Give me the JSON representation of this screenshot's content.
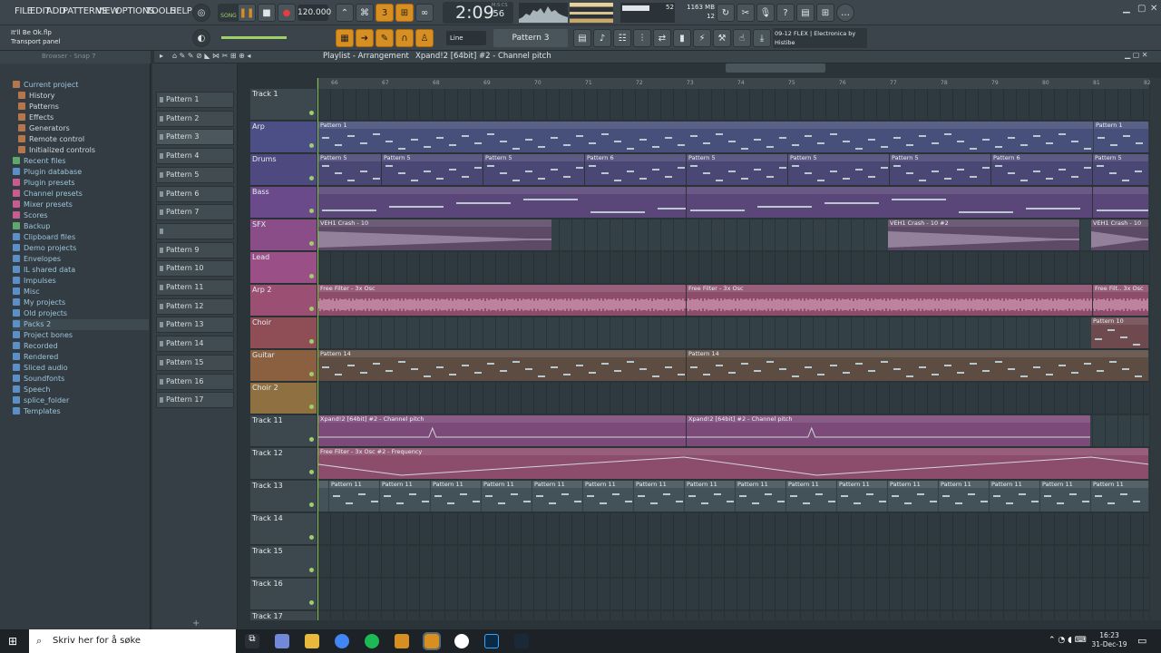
{
  "menu": [
    "FILE",
    "EDIT",
    "ADD",
    "PATTERNS",
    "VIEW",
    "OPTIONS",
    "TOOLS",
    "HELP"
  ],
  "transport": {
    "tempo": "120.000",
    "song_label": "SONG",
    "time": "2:09",
    "time_small": ":56",
    "time_unit": "M:S:CS",
    "cpu": "52",
    "mem": "1163 MB",
    "mem_sub": "12"
  },
  "project": {
    "file": "It'll Be Ok.flp",
    "hint": "Transport panel"
  },
  "toolbar2": {
    "snap_mode": "Line",
    "pattern": "Pattern 3",
    "news": "09-12 FLEX | Electronica by Histibe"
  },
  "browser": {
    "title": "Browser - Snap 7",
    "items": [
      {
        "label": "Current project",
        "type": "top",
        "color": "#b5764b"
      },
      {
        "label": "History",
        "type": "sub",
        "color": "#b5764b"
      },
      {
        "label": "Patterns",
        "type": "sub",
        "color": "#b5764b"
      },
      {
        "label": "Effects",
        "type": "sub",
        "color": "#b5764b"
      },
      {
        "label": "Generators",
        "type": "sub",
        "color": "#b5764b"
      },
      {
        "label": "Remote control",
        "type": "sub",
        "color": "#b5764b"
      },
      {
        "label": "Initialized controls",
        "type": "sub",
        "color": "#b5764b"
      },
      {
        "label": "Recent files",
        "type": "top",
        "color": "#5fa86b"
      },
      {
        "label": "Plugin database",
        "type": "top",
        "color": "#5b8fc8"
      },
      {
        "label": "Plugin presets",
        "type": "top",
        "color": "#c85b8f"
      },
      {
        "label": "Channel presets",
        "type": "top",
        "color": "#c85b8f"
      },
      {
        "label": "Mixer presets",
        "type": "top",
        "color": "#c85b8f"
      },
      {
        "label": "Scores",
        "type": "top",
        "color": "#c85b8f"
      },
      {
        "label": "Backup",
        "type": "top",
        "color": "#5fa86b"
      },
      {
        "label": "Clipboard files",
        "type": "top",
        "color": "#5b8fc8"
      },
      {
        "label": "Demo projects",
        "type": "top",
        "color": "#5b8fc8"
      },
      {
        "label": "Envelopes",
        "type": "top",
        "color": "#5b8fc8"
      },
      {
        "label": "IL shared data",
        "type": "top",
        "color": "#5b8fc8"
      },
      {
        "label": "Impulses",
        "type": "top",
        "color": "#5b8fc8"
      },
      {
        "label": "Misc",
        "type": "top",
        "color": "#5b8fc8"
      },
      {
        "label": "My projects",
        "type": "top",
        "color": "#5b8fc8"
      },
      {
        "label": "Old projects",
        "type": "top",
        "color": "#5b8fc8"
      },
      {
        "label": "Packs 2",
        "type": "top",
        "color": "#5b8fc8"
      },
      {
        "label": "Project bones",
        "type": "top",
        "color": "#5b8fc8"
      },
      {
        "label": "Recorded",
        "type": "top",
        "color": "#5b8fc8"
      },
      {
        "label": "Rendered",
        "type": "top",
        "color": "#5b8fc8"
      },
      {
        "label": "Sliced audio",
        "type": "top",
        "color": "#5b8fc8"
      },
      {
        "label": "Soundfonts",
        "type": "top",
        "color": "#5b8fc8"
      },
      {
        "label": "Speech",
        "type": "top",
        "color": "#5b8fc8"
      },
      {
        "label": "splice_folder",
        "type": "top",
        "color": "#5b8fc8"
      },
      {
        "label": "Templates",
        "type": "top",
        "color": "#5b8fc8"
      }
    ]
  },
  "patterns": [
    "Pattern 1",
    "Pattern 2",
    "Pattern 3",
    "Pattern 4",
    "Pattern 5",
    "Pattern 6",
    "Pattern 7",
    "",
    "Pattern 9",
    "Pattern 10",
    "Pattern 11",
    "Pattern 12",
    "Pattern 13",
    "Pattern 14",
    "Pattern 15",
    "Pattern 16",
    "Pattern 17"
  ],
  "playlist": {
    "title": "Playlist - Arrangement",
    "breadcrumb": "Xpand!2 [64bit] #2 - Channel pitch",
    "ruler": [
      "66",
      "67",
      "68",
      "69",
      "70",
      "71",
      "72",
      "73",
      "74",
      "75",
      "76",
      "77",
      "78",
      "79",
      "80",
      "81",
      "82"
    ],
    "tracks": [
      {
        "name": "Track 1",
        "color": "#3d484e",
        "clips": []
      },
      {
        "name": "Arp",
        "color": "#4b4f85",
        "clips": [
          {
            "l": 0,
            "w": 855,
            "label": "Pattern 1",
            "bg": "#47507a"
          },
          {
            "l": 855,
            "w": 61,
            "label": "Pattern 1",
            "bg": "#47507a"
          }
        ]
      },
      {
        "name": "Drums",
        "color": "#4e4a80",
        "clips": [
          {
            "l": 0,
            "w": 70,
            "label": "Pattern 5",
            "bg": "#4a4775"
          },
          {
            "l": 70,
            "w": 112,
            "label": "Pattern 5",
            "bg": "#4a4775"
          },
          {
            "l": 182,
            "w": 112,
            "label": "Pattern 5",
            "bg": "#4a4775"
          },
          {
            "l": 294,
            "w": 112,
            "label": "Pattern 6",
            "bg": "#4a4775"
          },
          {
            "l": 406,
            "w": 112,
            "label": "Pattern 5",
            "bg": "#4a4775"
          },
          {
            "l": 518,
            "w": 112,
            "label": "Pattern 5",
            "bg": "#4a4775"
          },
          {
            "l": 630,
            "w": 112,
            "label": "Pattern 5",
            "bg": "#4a4775"
          },
          {
            "l": 742,
            "w": 112,
            "label": "Pattern 6",
            "bg": "#4a4775"
          },
          {
            "l": 854,
            "w": 62,
            "label": "Pattern 5",
            "bg": "#4a4775"
          }
        ]
      },
      {
        "name": "Bass",
        "color": "#6b4a8c",
        "clips": [
          {
            "l": 0,
            "w": 406,
            "label": "",
            "bg": "#5a4678"
          },
          {
            "l": 406,
            "w": 448,
            "label": "",
            "bg": "#5a4678"
          },
          {
            "l": 854,
            "w": 62,
            "label": "",
            "bg": "#5a4678"
          }
        ]
      },
      {
        "name": "SFX",
        "color": "#8a4d88",
        "clips": [
          {
            "l": 0,
            "w": 258,
            "label": "VEH1 Crash - 10",
            "bg": "#5d4a66"
          },
          {
            "l": 628,
            "w": 212,
            "label": "VEH1 Crash - 10 #2",
            "bg": "#5d4a66"
          },
          {
            "l": 852,
            "w": 64,
            "label": "VEH1 Crash - 10",
            "bg": "#5d4a66"
          }
        ]
      },
      {
        "name": "Lead",
        "color": "#9a4f86",
        "clips": []
      },
      {
        "name": "Arp 2",
        "color": "#9a4f73",
        "clips": [
          {
            "l": 0,
            "w": 406,
            "label": "Free Filter - 3x Osc",
            "bg": "#8c4d6d"
          },
          {
            "l": 406,
            "w": 448,
            "label": "Free Filter - 3x Osc",
            "bg": "#8c4d6d"
          },
          {
            "l": 854,
            "w": 62,
            "label": "Free Filt.. 3x Osc",
            "bg": "#8c4d6d"
          }
        ]
      },
      {
        "name": "Choir",
        "color": "#8f4d55",
        "clips": [
          {
            "l": 852,
            "w": 64,
            "label": "Pattern 10",
            "bg": "#6e4a4e"
          }
        ]
      },
      {
        "name": "Guitar",
        "color": "#8a6040",
        "clips": [
          {
            "l": 0,
            "w": 406,
            "label": "Pattern 14",
            "bg": "#5d4c42"
          },
          {
            "l": 406,
            "w": 510,
            "label": "Pattern 14",
            "bg": "#5d4c42"
          }
        ]
      },
      {
        "name": "Choir 2",
        "color": "#8f7040",
        "clips": []
      },
      {
        "name": "Track 11",
        "color": "#3d484e",
        "clips": [
          {
            "l": 0,
            "w": 406,
            "label": "Xpand!2 [64bit] #2 - Channel pitch",
            "bg": "#7c4a78"
          },
          {
            "l": 406,
            "w": 446,
            "label": "Xpand!2 [64bit] #2 - Channel pitch",
            "bg": "#7c4a78"
          }
        ]
      },
      {
        "name": "Track 12",
        "color": "#3d484e",
        "clips": [
          {
            "l": 0,
            "w": 916,
            "label": "Free Filter - 3x Osc #2 - Frequency",
            "bg": "#8c4d6d"
          }
        ]
      },
      {
        "name": "Track 13",
        "color": "#3d484e",
        "clips": [
          {
            "l": 0,
            "w": 12,
            "label": "",
            "bg": "#425258"
          },
          {
            "l": 12,
            "w": 56,
            "label": "Pattern 11",
            "bg": "#425258"
          },
          {
            "l": 68,
            "w": 56,
            "label": "Pattern 11",
            "bg": "#425258"
          },
          {
            "l": 124,
            "w": 56,
            "label": "Pattern 11",
            "bg": "#425258"
          },
          {
            "l": 180,
            "w": 56,
            "label": "Pattern 11",
            "bg": "#425258"
          },
          {
            "l": 236,
            "w": 56,
            "label": "Pattern 11",
            "bg": "#425258"
          },
          {
            "l": 292,
            "w": 56,
            "label": "Pattern 11",
            "bg": "#425258"
          },
          {
            "l": 348,
            "w": 56,
            "label": "Pattern 11",
            "bg": "#425258"
          },
          {
            "l": 404,
            "w": 56,
            "label": "Pattern 11",
            "bg": "#425258"
          },
          {
            "l": 460,
            "w": 56,
            "label": "Pattern 11",
            "bg": "#425258"
          },
          {
            "l": 516,
            "w": 56,
            "label": "Pattern 11",
            "bg": "#425258"
          },
          {
            "l": 572,
            "w": 56,
            "label": "Pattern 11",
            "bg": "#425258"
          },
          {
            "l": 628,
            "w": 56,
            "label": "Pattern 11",
            "bg": "#425258"
          },
          {
            "l": 684,
            "w": 56,
            "label": "Pattern 11",
            "bg": "#425258"
          },
          {
            "l": 740,
            "w": 56,
            "label": "Pattern 11",
            "bg": "#425258"
          },
          {
            "l": 796,
            "w": 56,
            "label": "Pattern 11",
            "bg": "#425258"
          },
          {
            "l": 852,
            "w": 64,
            "label": "Pattern 11",
            "bg": "#425258"
          }
        ]
      },
      {
        "name": "Track 14",
        "color": "#3d484e",
        "clips": []
      },
      {
        "name": "Track 15",
        "color": "#3d484e",
        "clips": []
      },
      {
        "name": "Track 16",
        "color": "#3d484e",
        "clips": []
      },
      {
        "name": "Track 17",
        "color": "#3d484e",
        "clips": []
      }
    ]
  },
  "taskbar": {
    "search": "Skriv her for å søke",
    "time": "16:23",
    "date": "31-Dec-19"
  }
}
